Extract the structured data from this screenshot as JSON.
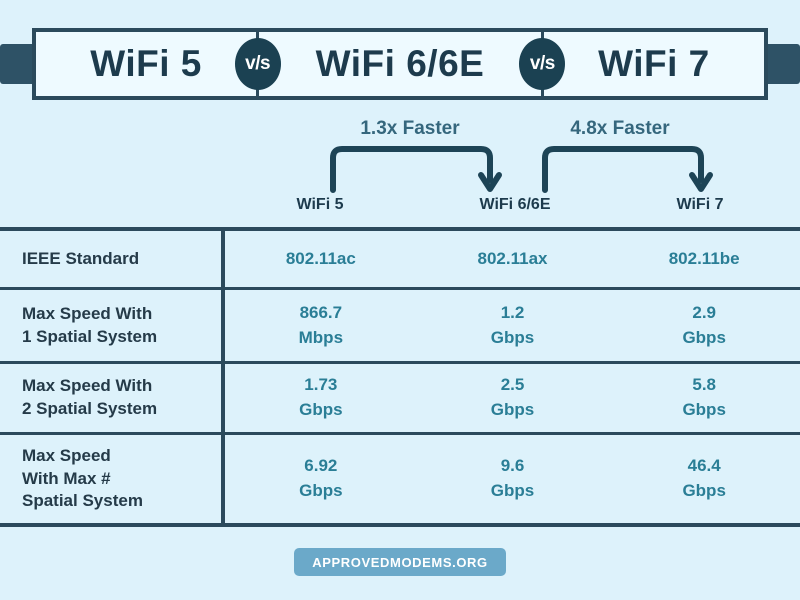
{
  "banner": {
    "items": [
      {
        "label": "WiFi 5"
      },
      {
        "label": "WiFi 6/6E"
      },
      {
        "label": "WiFi 7"
      }
    ],
    "vs_label": "v/s"
  },
  "comparisons": [
    {
      "label": "1.3x Faster",
      "from": "WiFi 5",
      "to": "WiFi 6/6E"
    },
    {
      "label": "4.8x Faster",
      "from": "WiFi 6/6E",
      "to": "WiFi 7"
    }
  ],
  "table": {
    "columns": [
      "WiFi 5",
      "WiFi 6/6E",
      "WiFi 7"
    ],
    "rows": [
      {
        "label": "IEEE Standard",
        "cells": [
          {
            "value": "802.11ac",
            "unit": ""
          },
          {
            "value": "802.11ax",
            "unit": ""
          },
          {
            "value": "802.11be",
            "unit": ""
          }
        ]
      },
      {
        "label": "Max Speed With\n1 Spatial System",
        "cells": [
          {
            "value": "866.7",
            "unit": "Mbps"
          },
          {
            "value": "1.2",
            "unit": "Gbps"
          },
          {
            "value": "2.9",
            "unit": "Gbps"
          }
        ]
      },
      {
        "label": "Max Speed With\n2 Spatial System",
        "cells": [
          {
            "value": "1.73",
            "unit": "Gbps"
          },
          {
            "value": "2.5",
            "unit": "Gbps"
          },
          {
            "value": "5.8",
            "unit": "Gbps"
          }
        ]
      },
      {
        "label": "Max Speed\nWith Max #\nSpatial System",
        "cells": [
          {
            "value": "6.92",
            "unit": "Gbps"
          },
          {
            "value": "9.6",
            "unit": "Gbps"
          },
          {
            "value": "46.4",
            "unit": "Gbps"
          }
        ]
      }
    ]
  },
  "footer": {
    "badge_label": "APPROVEDMODEMS.ORG"
  },
  "colors": {
    "background": "#ddf2fb",
    "dark_ink": "#1d3b4d",
    "border": "#2b4a5c",
    "tab": "#2e5266",
    "value_teal": "#2a7e96",
    "faster_text": "#35677d",
    "badge_bg": "#6ba9c9"
  }
}
